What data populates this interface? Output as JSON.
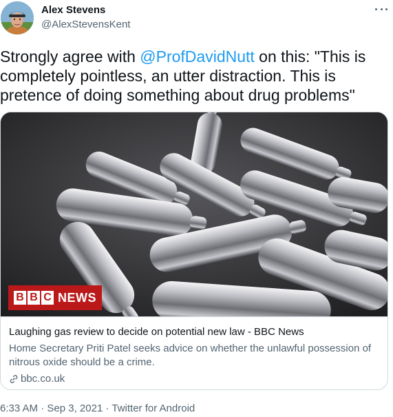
{
  "user": {
    "display_name": "Alex Stevens",
    "handle": "@AlexStevensKent",
    "avatar_icon": "user-avatar"
  },
  "tweet": {
    "text_before": "Strongly agree with ",
    "mention": "@ProfDavidNutt",
    "text_after": " on this: \"This is completely pointless, an utter distraction. This is pretence of doing something about drug problems\""
  },
  "card": {
    "image_icon": "nitrous-oxide-canisters-photo",
    "badge_letters": [
      "B",
      "B",
      "C"
    ],
    "badge_word": "NEWS",
    "title": "Laughing gas review to decide on potential new law - BBC News",
    "description": "Home Secretary Priti Patel seeks advice on whether the unlawful possession of nitrous oxide should be a crime.",
    "domain": "bbc.co.uk",
    "domain_icon": "link-icon"
  },
  "meta": {
    "time": "6:33 AM",
    "sep1": " · ",
    "date": "Sep 3, 2021",
    "sep2": " · ",
    "source": "Twitter for Android"
  },
  "colors": {
    "accent": "#1d9bf0",
    "text_primary": "#0f1419",
    "text_secondary": "#536471",
    "border": "#cfd9de",
    "bbc_red": "#bb1919"
  }
}
